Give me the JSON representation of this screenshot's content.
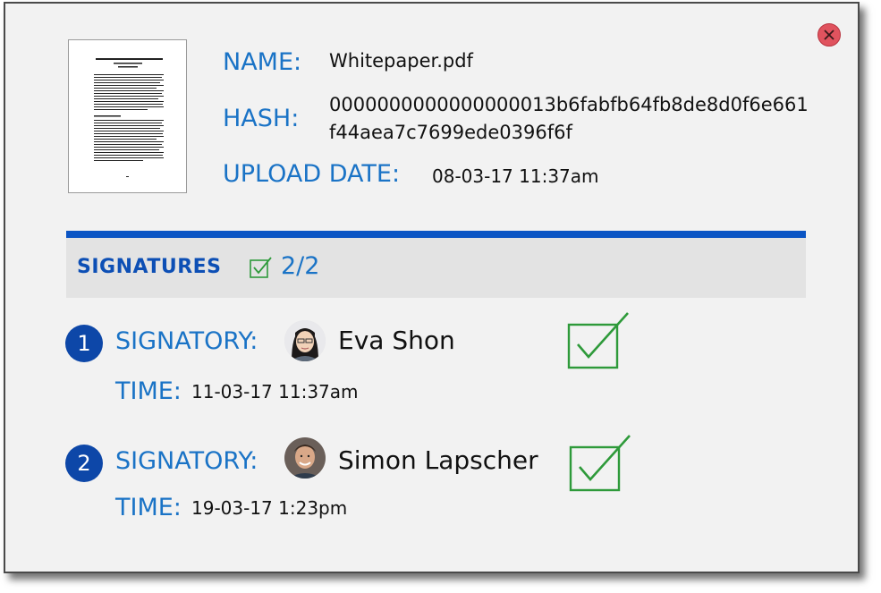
{
  "document": {
    "name_label": "NAME:",
    "name_value": "Whitepaper.pdf",
    "hash_label": "HASH:",
    "hash_line1": "0000000000000000013b6fabfb64fb8de8d0f6e661",
    "hash_line2": "f44aea7c7699ede0396f6f",
    "upload_label": "UPLOAD DATE:",
    "upload_value": "08-03-17 11:37am"
  },
  "signatures": {
    "title": "SIGNATURES",
    "count": "2/2",
    "items": [
      {
        "number": "1",
        "signatory_label": "SIGNATORY:",
        "name": "Eva Shon",
        "time_label": "TIME:",
        "time": "11-03-17 11:37am",
        "status": "signed"
      },
      {
        "number": "2",
        "signatory_label": "SIGNATORY:",
        "name": "Simon Lapscher",
        "time_label": "TIME:",
        "time": "19-03-17 1:23pm",
        "status": "signed"
      }
    ]
  },
  "icons": {
    "close": "close-icon",
    "count_check": "checkbox-check-icon",
    "signed_check": "checkbox-check-icon"
  },
  "colors": {
    "label_blue": "#1a73c6",
    "accent_bar": "#0b55c4",
    "badge": "#0d47a8",
    "check_green": "#2e9a3a",
    "close_red": "#e0535e"
  }
}
